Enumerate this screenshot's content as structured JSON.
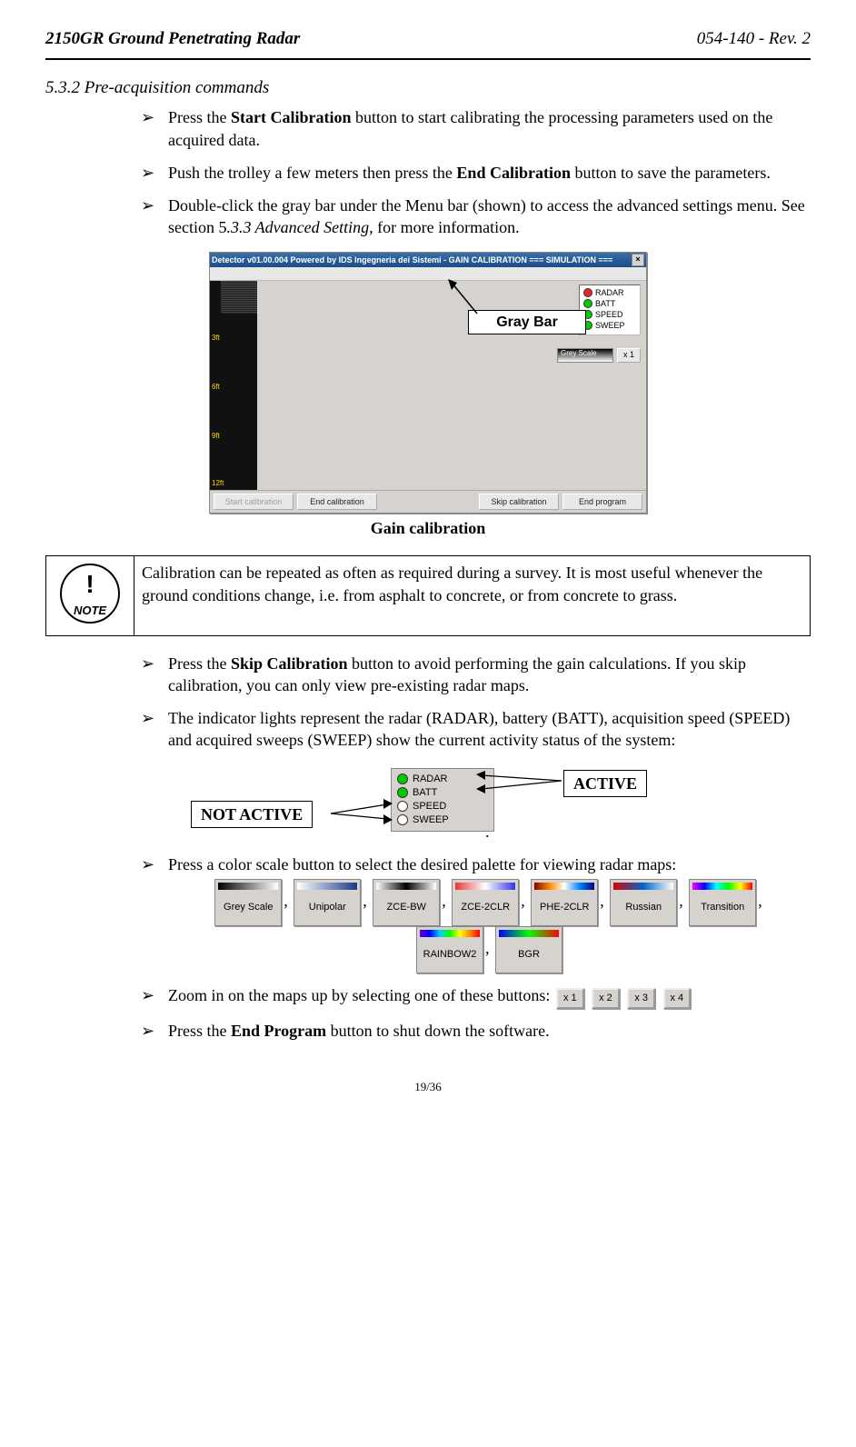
{
  "header": {
    "left": "2150GR Ground Penetrating Radar",
    "right": "054-140 - Rev. 2"
  },
  "section_title": "5.3.2 Pre-acquisition commands",
  "bullets_a": [
    {
      "pre": "Press the ",
      "bold": "Start Calibration",
      "post": " button to start calibrating the processing parameters used on the acquired data."
    },
    {
      "pre": "Push the trolley a few meters then press the ",
      "bold": "End Calibration",
      "post": " button to save the parameters."
    },
    {
      "pre": "Double-click the gray bar under the Menu bar (shown) to access the advanced settings menu. See section 5",
      "ital": ".3.3 Advanced Setting,",
      "post2": " for more information."
    }
  ],
  "app": {
    "title": "Detector v01.00.004 Powered by IDS Ingegneria dei Sistemi - GAIN CALIBRATION  === SIMULATION ===",
    "close": "×",
    "ticks": [
      "3ft",
      "6ft",
      "9ft",
      "12ft"
    ],
    "status": {
      "items": [
        "RADAR",
        "BATT",
        "SPEED",
        "SWEEP"
      ]
    },
    "grey_label": "Grey Scale",
    "mult": "x 1",
    "buttons": {
      "start": "Start calibration",
      "end": "End calibration",
      "skip": "Skip calibration",
      "prog": "End program"
    },
    "callout": "Gray Bar"
  },
  "caption": "Gain calibration",
  "note": {
    "bang": "!",
    "label": "NOTE",
    "text": "Calibration can be repeated as often as required during a survey. It is most useful whenever the ground conditions change, i.e. from asphalt to concrete, or from concrete to grass."
  },
  "bullets_b": [
    {
      "pre": "Press the ",
      "bold": "Skip Calibration",
      "post": " button to avoid performing the gain calculations. If you skip calibration, you can only view pre-existing radar maps."
    },
    {
      "plain": "The indicator lights represent the radar (RADAR), battery (BATT), acquisition speed (SPEED) and acquired sweeps (SWEEP) show the current activity status of the system:"
    }
  ],
  "indic": {
    "rows": [
      {
        "cls": "g",
        "t": "RADAR"
      },
      {
        "cls": "g",
        "t": "BATT"
      },
      {
        "cls": "o",
        "t": "SPEED"
      },
      {
        "cls": "o",
        "t": "SWEEP"
      }
    ],
    "active": "ACTIVE",
    "notactive": "NOT ACTIVE"
  },
  "bullets_c_intro": "Press a color scale button to select the desired palette for viewing radar maps:",
  "palettes": [
    "Grey Scale",
    "Unipolar",
    "ZCE-BW",
    "ZCE-2CLR",
    "PHE-2CLR",
    "Russian",
    "Transition",
    "RAINBOW2",
    "BGR"
  ],
  "bullets_d_pre": "Zoom in on the maps up by selecting one of these buttons: ",
  "zoom": [
    "x 1",
    "x 2",
    "x 3",
    "x 4"
  ],
  "bullets_e": {
    "pre": "Press the ",
    "bold": "End Program",
    "post": " button to shut down the software."
  },
  "pagenum": "19/36",
  "comma": ","
}
